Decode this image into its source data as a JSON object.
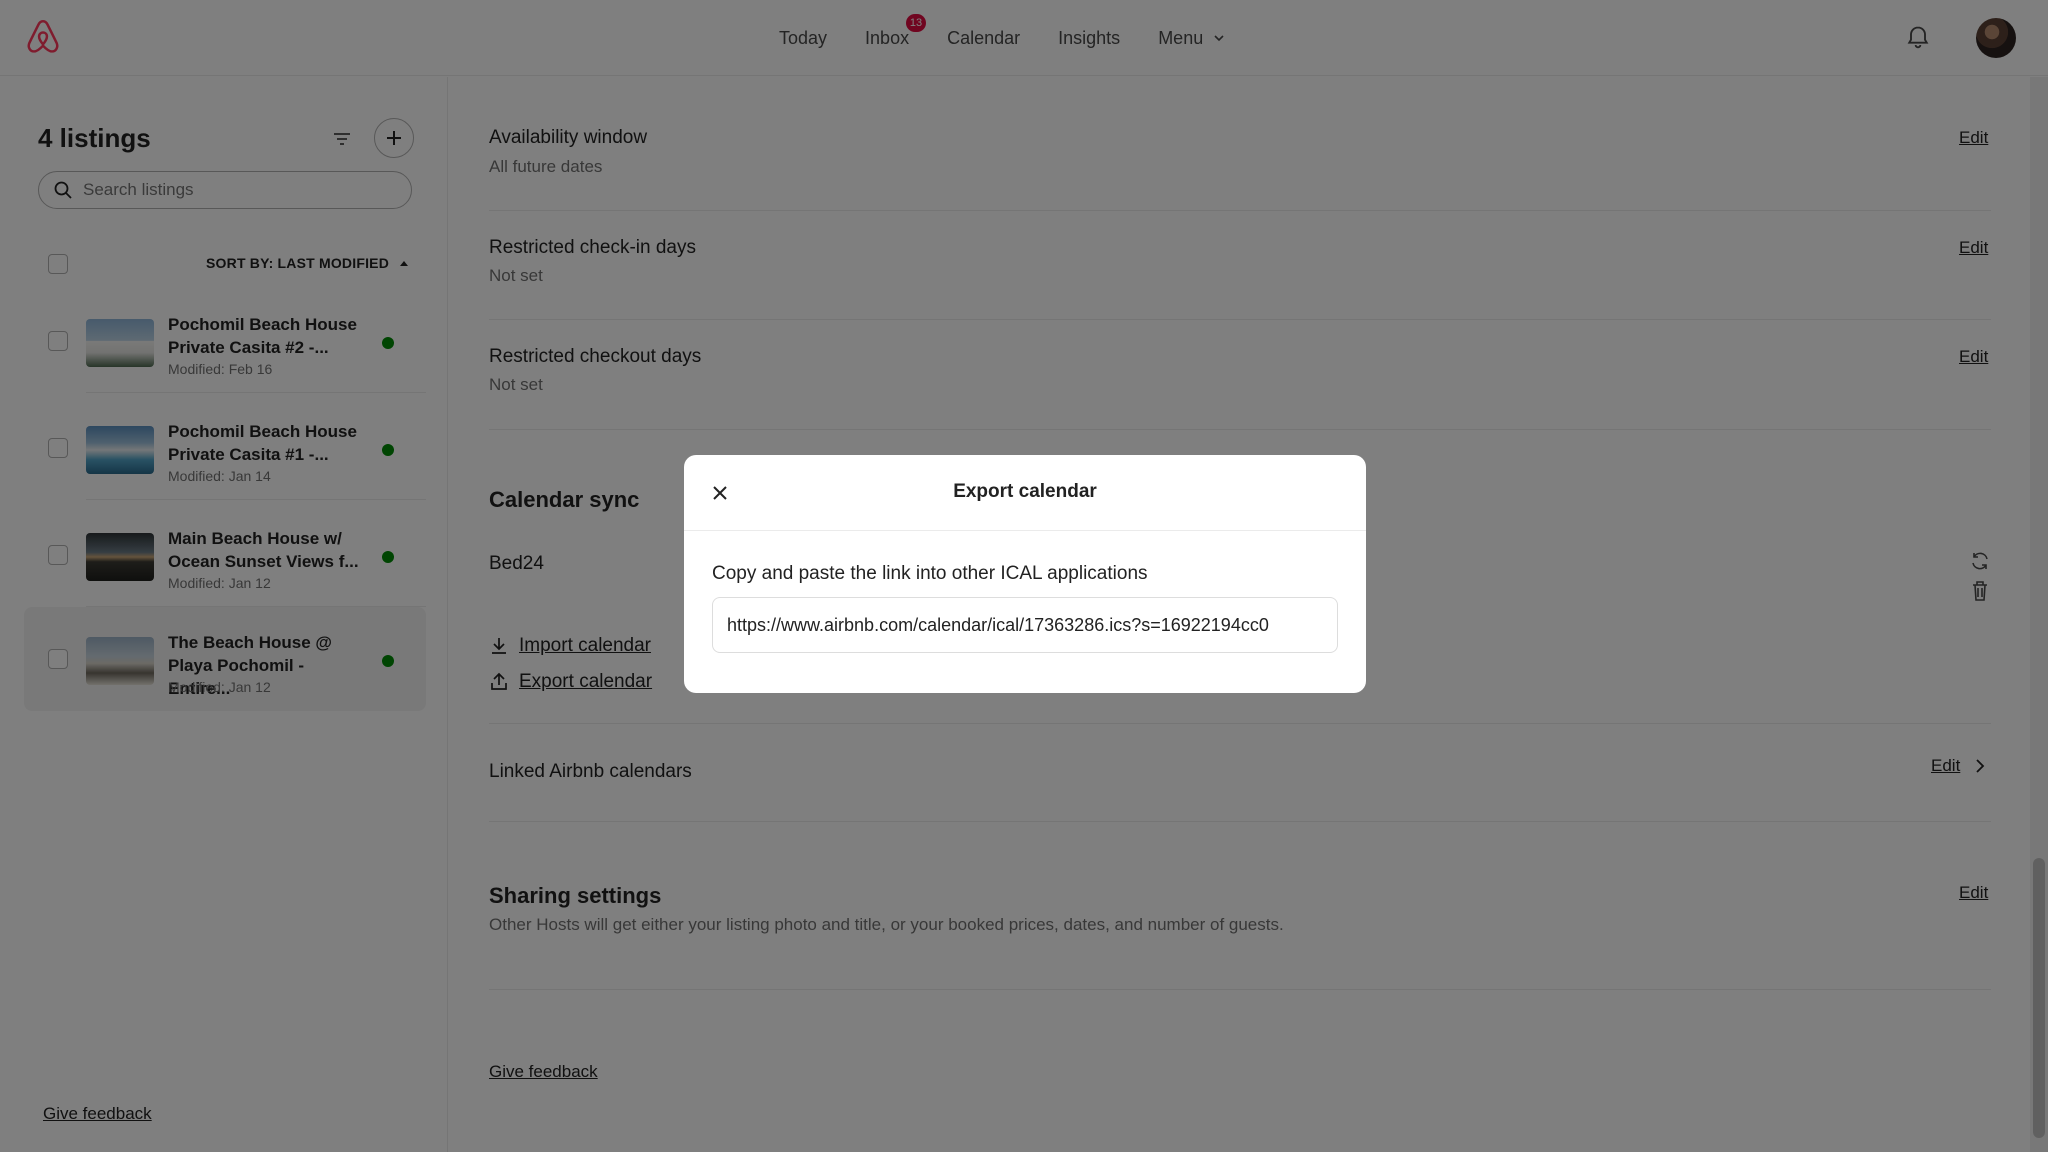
{
  "nav": {
    "items": [
      {
        "label": "Today"
      },
      {
        "label": "Inbox",
        "badge": "13"
      },
      {
        "label": "Calendar"
      },
      {
        "label": "Insights"
      },
      {
        "label": "Menu"
      }
    ],
    "icons": {
      "logo": "airbnb-logo",
      "bell": "bell-icon"
    }
  },
  "sidebar": {
    "title": "4 listings",
    "search_placeholder": "Search listings",
    "sort_label": "SORT BY: LAST MODIFIED",
    "listings": [
      {
        "name": "Pochomil Beach House Private Casita #2 -...",
        "modified": "Modified: Feb 16",
        "status_color": "#008a05"
      },
      {
        "name": "Pochomil Beach House Private Casita #1 -...",
        "modified": "Modified: Jan 14",
        "status_color": "#008a05"
      },
      {
        "name": "Main Beach House w/ Ocean Sunset Views f...",
        "modified": "Modified: Jan 12",
        "status_color": "#008a05"
      },
      {
        "name": "The Beach House @ Playa Pochomil - Entire...",
        "modified": "Modified: Jan 12",
        "status_color": "#008a05"
      }
    ],
    "give_feedback": "Give feedback"
  },
  "main": {
    "availability_window": {
      "title": "Availability window",
      "value": "All future dates",
      "edit": "Edit"
    },
    "restricted_checkin": {
      "title": "Restricted check-in days",
      "value": "Not set",
      "edit": "Edit"
    },
    "restricted_checkout": {
      "title": "Restricted checkout days",
      "value": "Not set",
      "edit": "Edit"
    },
    "calendar_sync": {
      "title": "Calendar sync",
      "synced_calendar": "Bed24",
      "import_label": "Import calendar",
      "export_label": "Export calendar"
    },
    "linked_calendars": {
      "title": "Linked Airbnb calendars",
      "edit": "Edit"
    },
    "sharing": {
      "title": "Sharing settings",
      "description": "Other Hosts will get either your listing photo and title, or your booked prices, dates, and number of guests.",
      "edit": "Edit"
    },
    "give_feedback": "Give feedback"
  },
  "modal": {
    "title": "Export calendar",
    "description": "Copy and paste the link into other ICAL applications",
    "url": "https://www.airbnb.com/calendar/ical/17363286.ics?s=16922194cc0"
  },
  "colors": {
    "accent": "#ff385c",
    "status_active": "#008a05",
    "badge": "#e00b41"
  }
}
